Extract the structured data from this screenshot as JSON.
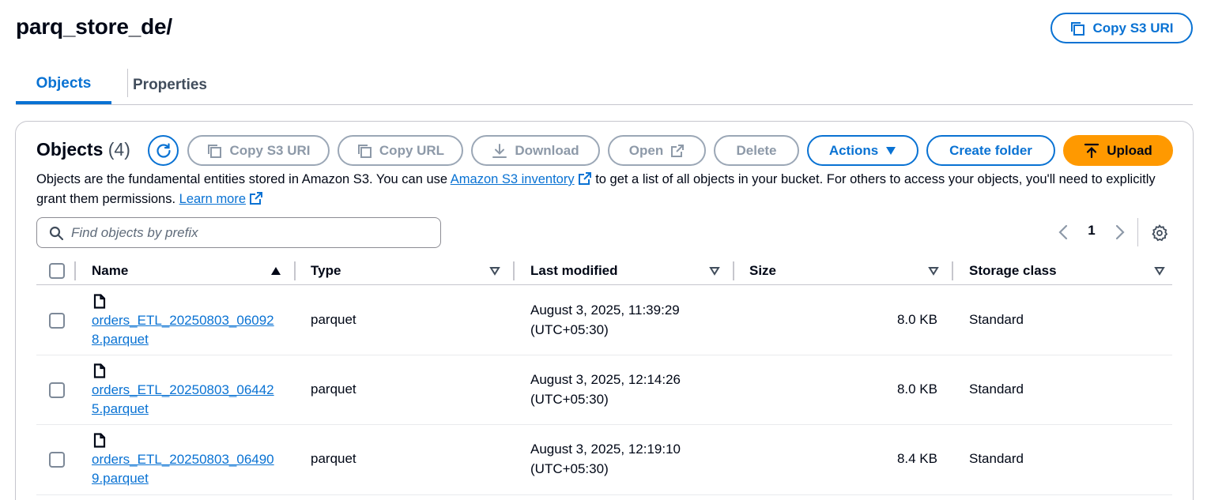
{
  "header": {
    "title": "parq_store_de/",
    "copy_uri_label": "Copy S3 URI"
  },
  "tabs": [
    {
      "label": "Objects",
      "active": true
    },
    {
      "label": "Properties",
      "active": false
    }
  ],
  "panel": {
    "title": "Objects",
    "count": "(4)",
    "buttons": {
      "copy_s3_uri": "Copy S3 URI",
      "copy_url": "Copy URL",
      "download": "Download",
      "open": "Open",
      "delete": "Delete",
      "actions": "Actions",
      "create_folder": "Create folder",
      "upload": "Upload"
    },
    "description": {
      "part1": "Objects are the fundamental entities stored in Amazon S3. You can use ",
      "link1": "Amazon S3 inventory",
      "part2": " to get a list of all objects in your bucket. For others to access your objects, you'll need to explicitly grant them permissions. ",
      "link2": "Learn more"
    },
    "search": {
      "placeholder": "Find objects by prefix",
      "value": ""
    },
    "pagination": {
      "current_page": "1"
    }
  },
  "table": {
    "columns": {
      "name": "Name",
      "type": "Type",
      "last_modified": "Last modified",
      "size": "Size",
      "storage_class": "Storage class"
    },
    "rows": [
      {
        "name": "orders_ETL_20250803_060928.parquet",
        "type": "parquet",
        "modified_line1": "August 3, 2025, 11:39:29",
        "modified_line2": "(UTC+05:30)",
        "size": "8.0 KB",
        "storage_class": "Standard"
      },
      {
        "name": "orders_ETL_20250803_064425.parquet",
        "type": "parquet",
        "modified_line1": "August 3, 2025, 12:14:26",
        "modified_line2": "(UTC+05:30)",
        "size": "8.0 KB",
        "storage_class": "Standard"
      },
      {
        "name": "orders_ETL_20250803_064909.parquet",
        "type": "parquet",
        "modified_line1": "August 3, 2025, 12:19:10",
        "modified_line2": "(UTC+05:30)",
        "size": "8.4 KB",
        "storage_class": "Standard"
      }
    ]
  },
  "colors": {
    "link_blue": "#0972d3",
    "upload_orange": "#ff9900",
    "disabled_gray": "#8d99a8",
    "border_gray": "#c6c6cd"
  },
  "icons": {
    "copy": "copy-icon",
    "refresh": "refresh-icon",
    "download": "download-icon",
    "external": "external-link-icon",
    "caret": "caret-down-icon",
    "upload": "upload-icon",
    "search": "search-icon",
    "file": "file-icon",
    "settings": "gear-icon"
  }
}
